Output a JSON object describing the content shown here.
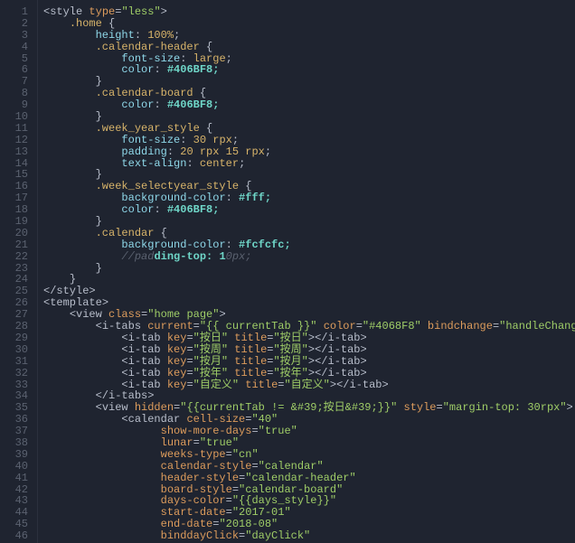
{
  "lines": [
    {
      "n": 1,
      "tokens": [
        [
          "<",
          "t-punc"
        ],
        [
          "style ",
          "t-tag"
        ],
        [
          "type",
          "t-attr"
        ],
        [
          "=",
          "t-punc"
        ],
        [
          "\"less\"",
          "t-str"
        ],
        [
          ">",
          "t-punc"
        ]
      ]
    },
    {
      "n": 2,
      "tokens": [
        [
          "    ",
          ""
        ],
        [
          ".home ",
          "t-sel"
        ],
        [
          "{",
          "t-punc"
        ]
      ]
    },
    {
      "n": 3,
      "tokens": [
        [
          "        ",
          ""
        ],
        [
          "height",
          "t-prop"
        ],
        [
          ": ",
          "t-punc"
        ],
        [
          "100%",
          "t-val"
        ],
        [
          ";",
          "t-punc"
        ]
      ]
    },
    {
      "n": 4,
      "tokens": [
        [
          "        ",
          ""
        ],
        [
          ".calendar-header ",
          "t-sel"
        ],
        [
          "{",
          "t-punc"
        ]
      ]
    },
    {
      "n": 5,
      "tokens": [
        [
          "            ",
          ""
        ],
        [
          "font-size",
          "t-prop"
        ],
        [
          ": ",
          "t-punc"
        ],
        [
          "large",
          "t-val"
        ],
        [
          ";",
          "t-punc"
        ]
      ]
    },
    {
      "n": 6,
      "tokens": [
        [
          "            ",
          ""
        ],
        [
          "color",
          "t-prop"
        ],
        [
          ": ",
          "t-punc"
        ],
        [
          "#406BF8;",
          "t-hex"
        ]
      ]
    },
    {
      "n": 7,
      "tokens": [
        [
          "        ",
          ""
        ],
        [
          "}",
          "t-punc"
        ]
      ]
    },
    {
      "n": 8,
      "tokens": [
        [
          "        ",
          ""
        ],
        [
          ".calendar-board ",
          "t-sel"
        ],
        [
          "{",
          "t-punc"
        ]
      ]
    },
    {
      "n": 9,
      "tokens": [
        [
          "            ",
          ""
        ],
        [
          "color",
          "t-prop"
        ],
        [
          ": ",
          "t-punc"
        ],
        [
          "#406BF8;",
          "t-hex"
        ]
      ]
    },
    {
      "n": 10,
      "tokens": [
        [
          "        ",
          ""
        ],
        [
          "}",
          "t-punc"
        ]
      ]
    },
    {
      "n": 11,
      "tokens": [
        [
          "        ",
          ""
        ],
        [
          ".week_year_style ",
          "t-sel"
        ],
        [
          "{",
          "t-punc"
        ]
      ]
    },
    {
      "n": 12,
      "tokens": [
        [
          "            ",
          ""
        ],
        [
          "font-size",
          "t-prop"
        ],
        [
          ": ",
          "t-punc"
        ],
        [
          "30 rpx",
          "t-val"
        ],
        [
          ";",
          "t-punc"
        ]
      ]
    },
    {
      "n": 13,
      "tokens": [
        [
          "            ",
          ""
        ],
        [
          "padding",
          "t-prop"
        ],
        [
          ": ",
          "t-punc"
        ],
        [
          "20 rpx 15 rpx",
          "t-val"
        ],
        [
          ";",
          "t-punc"
        ]
      ]
    },
    {
      "n": 14,
      "tokens": [
        [
          "            ",
          ""
        ],
        [
          "text-align",
          "t-prop"
        ],
        [
          ": ",
          "t-punc"
        ],
        [
          "center",
          "t-val"
        ],
        [
          ";",
          "t-punc"
        ]
      ]
    },
    {
      "n": 15,
      "tokens": [
        [
          "        ",
          ""
        ],
        [
          "}",
          "t-punc"
        ]
      ]
    },
    {
      "n": 16,
      "tokens": [
        [
          "        ",
          ""
        ],
        [
          ".week_selectyear_style ",
          "t-sel"
        ],
        [
          "{",
          "t-punc"
        ]
      ]
    },
    {
      "n": 17,
      "tokens": [
        [
          "            ",
          ""
        ],
        [
          "background-color",
          "t-prop"
        ],
        [
          ": ",
          "t-punc"
        ],
        [
          "#fff;",
          "t-hex"
        ]
      ]
    },
    {
      "n": 18,
      "tokens": [
        [
          "            ",
          ""
        ],
        [
          "color",
          "t-prop"
        ],
        [
          ": ",
          "t-punc"
        ],
        [
          "#406BF8;",
          "t-hex"
        ]
      ]
    },
    {
      "n": 19,
      "tokens": [
        [
          "        ",
          ""
        ],
        [
          "}",
          "t-punc"
        ]
      ]
    },
    {
      "n": 20,
      "tokens": [
        [
          "        ",
          ""
        ],
        [
          ".calendar ",
          "t-sel"
        ],
        [
          "{",
          "t-punc"
        ]
      ]
    },
    {
      "n": 21,
      "tokens": [
        [
          "            ",
          ""
        ],
        [
          "background-color",
          "t-prop"
        ],
        [
          ": ",
          "t-punc"
        ],
        [
          "#fcfcfc;",
          "t-hex"
        ]
      ]
    },
    {
      "n": 22,
      "tokens": [
        [
          "            ",
          ""
        ],
        [
          "//pad",
          "t-cmt"
        ],
        [
          "ding-top: 1",
          "t-hex"
        ],
        [
          "0px;",
          "t-cmt"
        ]
      ]
    },
    {
      "n": 23,
      "tokens": [
        [
          "        ",
          ""
        ],
        [
          "}",
          "t-punc"
        ]
      ]
    },
    {
      "n": 24,
      "tokens": [
        [
          "    ",
          ""
        ],
        [
          "}",
          "t-punc"
        ]
      ]
    },
    {
      "n": 25,
      "tokens": [
        [
          "</",
          "t-punc"
        ],
        [
          "style",
          "t-tag"
        ],
        [
          ">",
          "t-punc"
        ]
      ]
    },
    {
      "n": 26,
      "tokens": [
        [
          "<",
          "t-punc"
        ],
        [
          "template",
          "t-tag"
        ],
        [
          ">",
          "t-punc"
        ]
      ]
    },
    {
      "n": 27,
      "tokens": [
        [
          "    ",
          ""
        ],
        [
          "<",
          "t-punc"
        ],
        [
          "view ",
          "t-tag"
        ],
        [
          "class",
          "t-attr"
        ],
        [
          "=",
          "t-punc"
        ],
        [
          "\"home page\"",
          "t-str"
        ],
        [
          ">",
          "t-punc"
        ]
      ]
    },
    {
      "n": 28,
      "tokens": [
        [
          "        ",
          ""
        ],
        [
          "<",
          "t-punc"
        ],
        [
          "i-tabs ",
          "t-tag"
        ],
        [
          "current",
          "t-attr"
        ],
        [
          "=",
          "t-punc"
        ],
        [
          "\"{{ currentTab }}\"",
          "t-str"
        ],
        [
          " ",
          ""
        ],
        [
          "color",
          "t-attr"
        ],
        [
          "=",
          "t-punc"
        ],
        [
          "\"#4068F8\"",
          "t-str"
        ],
        [
          " ",
          ""
        ],
        [
          "bindchange",
          "t-attr"
        ],
        [
          "=",
          "t-punc"
        ],
        [
          "\"handleChangeTab\"",
          "t-str"
        ],
        [
          ">",
          "t-punc"
        ]
      ]
    },
    {
      "n": 29,
      "tokens": [
        [
          "            ",
          ""
        ],
        [
          "<",
          "t-punc"
        ],
        [
          "i-tab ",
          "t-tag"
        ],
        [
          "key",
          "t-attr"
        ],
        [
          "=",
          "t-punc"
        ],
        [
          "\"按日\"",
          "t-str"
        ],
        [
          " ",
          ""
        ],
        [
          "title",
          "t-attr"
        ],
        [
          "=",
          "t-punc"
        ],
        [
          "\"按日\"",
          "t-str"
        ],
        [
          "></",
          "t-punc"
        ],
        [
          "i-tab",
          "t-tag"
        ],
        [
          ">",
          "t-punc"
        ]
      ]
    },
    {
      "n": 30,
      "tokens": [
        [
          "            ",
          ""
        ],
        [
          "<",
          "t-punc"
        ],
        [
          "i-tab ",
          "t-tag"
        ],
        [
          "key",
          "t-attr"
        ],
        [
          "=",
          "t-punc"
        ],
        [
          "\"按周\"",
          "t-str"
        ],
        [
          " ",
          ""
        ],
        [
          "title",
          "t-attr"
        ],
        [
          "=",
          "t-punc"
        ],
        [
          "\"按周\"",
          "t-str"
        ],
        [
          "></",
          "t-punc"
        ],
        [
          "i-tab",
          "t-tag"
        ],
        [
          ">",
          "t-punc"
        ]
      ]
    },
    {
      "n": 31,
      "tokens": [
        [
          "            ",
          ""
        ],
        [
          "<",
          "t-punc"
        ],
        [
          "i-tab ",
          "t-tag"
        ],
        [
          "key",
          "t-attr"
        ],
        [
          "=",
          "t-punc"
        ],
        [
          "\"按月\"",
          "t-str"
        ],
        [
          " ",
          ""
        ],
        [
          "title",
          "t-attr"
        ],
        [
          "=",
          "t-punc"
        ],
        [
          "\"按月\"",
          "t-str"
        ],
        [
          "></",
          "t-punc"
        ],
        [
          "i-tab",
          "t-tag"
        ],
        [
          ">",
          "t-punc"
        ]
      ]
    },
    {
      "n": 32,
      "tokens": [
        [
          "            ",
          ""
        ],
        [
          "<",
          "t-punc"
        ],
        [
          "i-tab ",
          "t-tag"
        ],
        [
          "key",
          "t-attr"
        ],
        [
          "=",
          "t-punc"
        ],
        [
          "\"按年\"",
          "t-str"
        ],
        [
          " ",
          ""
        ],
        [
          "title",
          "t-attr"
        ],
        [
          "=",
          "t-punc"
        ],
        [
          "\"按年\"",
          "t-str"
        ],
        [
          "></",
          "t-punc"
        ],
        [
          "i-tab",
          "t-tag"
        ],
        [
          ">",
          "t-punc"
        ]
      ]
    },
    {
      "n": 33,
      "tokens": [
        [
          "            ",
          ""
        ],
        [
          "<",
          "t-punc"
        ],
        [
          "i-tab ",
          "t-tag"
        ],
        [
          "key",
          "t-attr"
        ],
        [
          "=",
          "t-punc"
        ],
        [
          "\"自定义\"",
          "t-str"
        ],
        [
          " ",
          ""
        ],
        [
          "title",
          "t-attr"
        ],
        [
          "=",
          "t-punc"
        ],
        [
          "\"自定义\"",
          "t-str"
        ],
        [
          "></",
          "t-punc"
        ],
        [
          "i-tab",
          "t-tag"
        ],
        [
          ">",
          "t-punc"
        ]
      ]
    },
    {
      "n": 34,
      "tokens": [
        [
          "        ",
          ""
        ],
        [
          "</",
          "t-punc"
        ],
        [
          "i-tabs",
          "t-tag"
        ],
        [
          ">",
          "t-punc"
        ]
      ]
    },
    {
      "n": 35,
      "tokens": [
        [
          "        ",
          ""
        ],
        [
          "<",
          "t-punc"
        ],
        [
          "view ",
          "t-tag"
        ],
        [
          "hidden",
          "t-attr"
        ],
        [
          "=",
          "t-punc"
        ],
        [
          "\"{{currentTab != &#39;按日&#39;}}\"",
          "t-str"
        ],
        [
          " ",
          ""
        ],
        [
          "style",
          "t-attr"
        ],
        [
          "=",
          "t-punc"
        ],
        [
          "\"margin-top: 30rpx\"",
          "t-str"
        ],
        [
          ">",
          "t-punc"
        ]
      ]
    },
    {
      "n": 36,
      "tokens": [
        [
          "            ",
          ""
        ],
        [
          "<",
          "t-punc"
        ],
        [
          "calendar ",
          "t-tag"
        ],
        [
          "cell-size",
          "t-attr"
        ],
        [
          "=",
          "t-punc"
        ],
        [
          "\"40\"",
          "t-str"
        ]
      ]
    },
    {
      "n": 37,
      "tokens": [
        [
          "                  ",
          ""
        ],
        [
          "show-more-days",
          "t-attr"
        ],
        [
          "=",
          "t-punc"
        ],
        [
          "\"true\"",
          "t-str"
        ]
      ]
    },
    {
      "n": 38,
      "tokens": [
        [
          "                  ",
          ""
        ],
        [
          "lunar",
          "t-attr"
        ],
        [
          "=",
          "t-punc"
        ],
        [
          "\"true\"",
          "t-str"
        ]
      ]
    },
    {
      "n": 39,
      "tokens": [
        [
          "                  ",
          ""
        ],
        [
          "weeks-type",
          "t-attr"
        ],
        [
          "=",
          "t-punc"
        ],
        [
          "\"cn\"",
          "t-str"
        ]
      ]
    },
    {
      "n": 40,
      "tokens": [
        [
          "                  ",
          ""
        ],
        [
          "calendar-style",
          "t-attr"
        ],
        [
          "=",
          "t-punc"
        ],
        [
          "\"calendar\"",
          "t-str"
        ]
      ]
    },
    {
      "n": 41,
      "tokens": [
        [
          "                  ",
          ""
        ],
        [
          "header-style",
          "t-attr"
        ],
        [
          "=",
          "t-punc"
        ],
        [
          "\"calendar-header\"",
          "t-str"
        ]
      ]
    },
    {
      "n": 42,
      "tokens": [
        [
          "                  ",
          ""
        ],
        [
          "board-style",
          "t-attr"
        ],
        [
          "=",
          "t-punc"
        ],
        [
          "\"calendar-board\"",
          "t-str"
        ]
      ]
    },
    {
      "n": 43,
      "tokens": [
        [
          "                  ",
          ""
        ],
        [
          "days-color",
          "t-attr"
        ],
        [
          "=",
          "t-punc"
        ],
        [
          "\"{{days_style}}\"",
          "t-str"
        ]
      ]
    },
    {
      "n": 44,
      "tokens": [
        [
          "                  ",
          ""
        ],
        [
          "start-date",
          "t-attr"
        ],
        [
          "=",
          "t-punc"
        ],
        [
          "\"2017-01\"",
          "t-str"
        ]
      ]
    },
    {
      "n": 45,
      "tokens": [
        [
          "                  ",
          ""
        ],
        [
          "end-date",
          "t-attr"
        ],
        [
          "=",
          "t-punc"
        ],
        [
          "\"2018-08\"",
          "t-str"
        ]
      ]
    },
    {
      "n": 46,
      "tokens": [
        [
          "                  ",
          ""
        ],
        [
          "binddayClick",
          "t-attr"
        ],
        [
          "=",
          "t-punc"
        ],
        [
          "\"dayClick\"",
          "t-str"
        ]
      ]
    }
  ]
}
